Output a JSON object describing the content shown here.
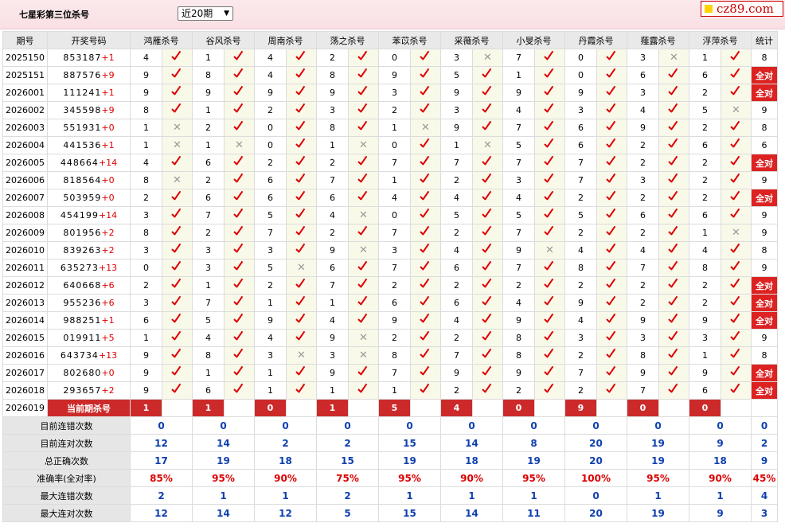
{
  "header": {
    "title": "七星彩第三位杀号",
    "select_value": "近20期",
    "logo": "cz89.com"
  },
  "columns": [
    "期号",
    "开奖号码",
    "鸿雁杀号",
    "谷风杀号",
    "周南杀号",
    "荡之杀号",
    "苯苡杀号",
    "采薇杀号",
    "小旻杀号",
    "丹霞杀号",
    "薤露杀号",
    "浮萍杀号",
    "统计"
  ],
  "rows": [
    {
      "period": "2025150",
      "draw": "853187",
      "delta": "+1",
      "k": [
        "4",
        "1",
        "4",
        "2",
        "0",
        "3",
        "7",
        "0",
        "3",
        "1"
      ],
      "ok": [
        1,
        1,
        1,
        1,
        1,
        0,
        1,
        1,
        0,
        1
      ],
      "stat": "8"
    },
    {
      "period": "2025151",
      "draw": "887576",
      "delta": "+9",
      "k": [
        "9",
        "8",
        "4",
        "8",
        "9",
        "5",
        "1",
        "0",
        "6",
        "6"
      ],
      "ok": [
        1,
        1,
        1,
        1,
        1,
        1,
        1,
        1,
        1,
        1
      ],
      "stat": "全对"
    },
    {
      "period": "2026001",
      "draw": "111241",
      "delta": "+1",
      "k": [
        "9",
        "9",
        "9",
        "9",
        "3",
        "9",
        "9",
        "9",
        "3",
        "2"
      ],
      "ok": [
        1,
        1,
        1,
        1,
        1,
        1,
        1,
        1,
        1,
        1
      ],
      "stat": "全对"
    },
    {
      "period": "2026002",
      "draw": "345598",
      "delta": "+9",
      "k": [
        "8",
        "1",
        "2",
        "3",
        "2",
        "3",
        "4",
        "3",
        "4",
        "5"
      ],
      "ok": [
        1,
        1,
        1,
        1,
        1,
        1,
        1,
        1,
        1,
        0
      ],
      "stat": "9"
    },
    {
      "period": "2026003",
      "draw": "551931",
      "delta": "+0",
      "k": [
        "1",
        "2",
        "0",
        "8",
        "1",
        "9",
        "7",
        "6",
        "9",
        "2"
      ],
      "ok": [
        0,
        1,
        1,
        1,
        0,
        1,
        1,
        1,
        1,
        1
      ],
      "stat": "8"
    },
    {
      "period": "2026004",
      "draw": "441536",
      "delta": "+1",
      "k": [
        "1",
        "1",
        "0",
        "1",
        "0",
        "1",
        "5",
        "6",
        "2",
        "6"
      ],
      "ok": [
        0,
        0,
        1,
        0,
        1,
        0,
        1,
        1,
        1,
        1
      ],
      "stat": "6"
    },
    {
      "period": "2026005",
      "draw": "448664",
      "delta": "+14",
      "k": [
        "4",
        "6",
        "2",
        "2",
        "7",
        "7",
        "7",
        "7",
        "2",
        "2"
      ],
      "ok": [
        1,
        1,
        1,
        1,
        1,
        1,
        1,
        1,
        1,
        1
      ],
      "stat": "全对"
    },
    {
      "period": "2026006",
      "draw": "818564",
      "delta": "+0",
      "k": [
        "8",
        "2",
        "6",
        "7",
        "1",
        "2",
        "3",
        "7",
        "3",
        "2"
      ],
      "ok": [
        0,
        1,
        1,
        1,
        1,
        1,
        1,
        1,
        1,
        1
      ],
      "stat": "9"
    },
    {
      "period": "2026007",
      "draw": "503959",
      "delta": "+0",
      "k": [
        "2",
        "6",
        "6",
        "6",
        "4",
        "4",
        "4",
        "2",
        "2",
        "2"
      ],
      "ok": [
        1,
        1,
        1,
        1,
        1,
        1,
        1,
        1,
        1,
        1
      ],
      "stat": "全对"
    },
    {
      "period": "2026008",
      "draw": "454199",
      "delta": "+14",
      "k": [
        "3",
        "7",
        "5",
        "4",
        "0",
        "5",
        "5",
        "5",
        "6",
        "6"
      ],
      "ok": [
        1,
        1,
        1,
        0,
        1,
        1,
        1,
        1,
        1,
        1
      ],
      "stat": "9"
    },
    {
      "period": "2026009",
      "draw": "801956",
      "delta": "+2",
      "k": [
        "8",
        "2",
        "7",
        "2",
        "7",
        "2",
        "7",
        "2",
        "2",
        "1"
      ],
      "ok": [
        1,
        1,
        1,
        1,
        1,
        1,
        1,
        1,
        1,
        0
      ],
      "stat": "9"
    },
    {
      "period": "2026010",
      "draw": "839263",
      "delta": "+2",
      "k": [
        "3",
        "3",
        "3",
        "9",
        "3",
        "4",
        "9",
        "4",
        "4",
        "4"
      ],
      "ok": [
        1,
        1,
        1,
        0,
        1,
        1,
        0,
        1,
        1,
        1
      ],
      "stat": "8"
    },
    {
      "period": "2026011",
      "draw": "635273",
      "delta": "+13",
      "k": [
        "0",
        "3",
        "5",
        "6",
        "7",
        "6",
        "7",
        "8",
        "7",
        "8"
      ],
      "ok": [
        1,
        1,
        0,
        1,
        1,
        1,
        1,
        1,
        1,
        1
      ],
      "stat": "9"
    },
    {
      "period": "2026012",
      "draw": "640668",
      "delta": "+6",
      "k": [
        "2",
        "1",
        "2",
        "7",
        "2",
        "2",
        "2",
        "2",
        "2",
        "2"
      ],
      "ok": [
        1,
        1,
        1,
        1,
        1,
        1,
        1,
        1,
        1,
        1
      ],
      "stat": "全对"
    },
    {
      "period": "2026013",
      "draw": "955236",
      "delta": "+6",
      "k": [
        "3",
        "7",
        "1",
        "1",
        "6",
        "6",
        "4",
        "9",
        "2",
        "2"
      ],
      "ok": [
        1,
        1,
        1,
        1,
        1,
        1,
        1,
        1,
        1,
        1
      ],
      "stat": "全对"
    },
    {
      "period": "2026014",
      "draw": "988251",
      "delta": "+1",
      "k": [
        "6",
        "5",
        "9",
        "4",
        "9",
        "4",
        "9",
        "4",
        "9",
        "9"
      ],
      "ok": [
        1,
        1,
        1,
        1,
        1,
        1,
        1,
        1,
        1,
        1
      ],
      "stat": "全对"
    },
    {
      "period": "2026015",
      "draw": "019911",
      "delta": "+5",
      "k": [
        "1",
        "4",
        "4",
        "9",
        "2",
        "2",
        "8",
        "3",
        "3",
        "3"
      ],
      "ok": [
        1,
        1,
        1,
        0,
        1,
        1,
        1,
        1,
        1,
        1
      ],
      "stat": "9"
    },
    {
      "period": "2026016",
      "draw": "643734",
      "delta": "+13",
      "k": [
        "9",
        "8",
        "3",
        "3",
        "8",
        "7",
        "8",
        "2",
        "8",
        "1"
      ],
      "ok": [
        1,
        1,
        0,
        0,
        1,
        1,
        1,
        1,
        1,
        1
      ],
      "stat": "8"
    },
    {
      "period": "2026017",
      "draw": "802680",
      "delta": "+0",
      "k": [
        "9",
        "1",
        "1",
        "9",
        "7",
        "9",
        "9",
        "7",
        "9",
        "9"
      ],
      "ok": [
        1,
        1,
        1,
        1,
        1,
        1,
        1,
        1,
        1,
        1
      ],
      "stat": "全对"
    },
    {
      "period": "2026018",
      "draw": "293657",
      "delta": "+2",
      "k": [
        "9",
        "6",
        "1",
        "1",
        "1",
        "2",
        "2",
        "2",
        "7",
        "6"
      ],
      "ok": [
        1,
        1,
        1,
        1,
        1,
        1,
        1,
        1,
        1,
        1
      ],
      "stat": "全对"
    }
  ],
  "current": {
    "period": "2026019",
    "label": "当前期杀号",
    "k": [
      "1",
      "1",
      "0",
      "1",
      "5",
      "4",
      "0",
      "9",
      "0",
      "0"
    ]
  },
  "summary": [
    {
      "label": "目前连错次数",
      "v": [
        "0",
        "0",
        "0",
        "0",
        "0",
        "0",
        "0",
        "0",
        "0",
        "0",
        "0"
      ],
      "pct": false
    },
    {
      "label": "目前连对次数",
      "v": [
        "12",
        "14",
        "2",
        "2",
        "15",
        "14",
        "8",
        "20",
        "19",
        "9",
        "2"
      ],
      "pct": false
    },
    {
      "label": "总正确次数",
      "v": [
        "17",
        "19",
        "18",
        "15",
        "19",
        "18",
        "19",
        "20",
        "19",
        "18",
        "9"
      ],
      "pct": false
    },
    {
      "label": "准确率(全对率)",
      "v": [
        "85%",
        "95%",
        "90%",
        "75%",
        "95%",
        "90%",
        "95%",
        "100%",
        "95%",
        "90%",
        "45%"
      ],
      "pct": true
    },
    {
      "label": "最大连错次数",
      "v": [
        "2",
        "1",
        "1",
        "2",
        "1",
        "1",
        "1",
        "0",
        "1",
        "1",
        "4"
      ],
      "pct": false
    },
    {
      "label": "最大连对次数",
      "v": [
        "12",
        "14",
        "12",
        "5",
        "15",
        "14",
        "11",
        "20",
        "19",
        "9",
        "3"
      ],
      "pct": false
    }
  ]
}
